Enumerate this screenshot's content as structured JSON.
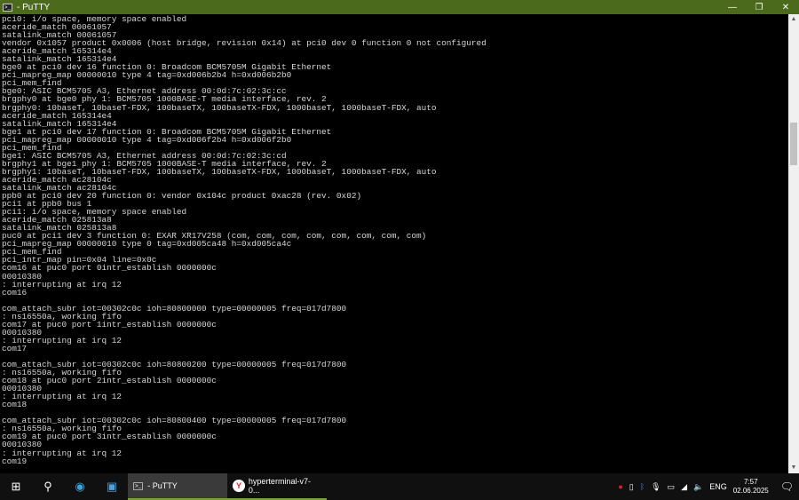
{
  "window": {
    "title": " - PuTTY",
    "minimize": "—",
    "maximize": "❐",
    "close": "✕"
  },
  "terminal": {
    "lines": [
      "pci0: i/o space, memory space enabled",
      "aceride_match 00061057",
      "satalink_match 00061057",
      "vendor 0x1057 product 0x0006 (host bridge, revision 0x14) at pci0 dev 0 function 0 not configured",
      "aceride_match 165314e4",
      "satalink_match 165314e4",
      "bge0 at pci0 dev 16 function 0: Broadcom BCM5705M Gigabit Ethernet",
      "pci_mapreg_map 00000010 type 4 tag=0xd006b2b4 h=0xd006b2b0",
      "pci_mem_find",
      "bge0: ASIC BCM5705 A3, Ethernet address 00:0d:7c:02:3c:cc",
      "brgphy0 at bge0 phy 1: BCM5705 1000BASE-T media interface, rev. 2",
      "brgphy0: 10baseT, 10baseT-FDX, 100baseTX, 100baseTX-FDX, 1000baseT, 1000baseT-FDX, auto",
      "aceride_match 165314e4",
      "satalink_match 165314e4",
      "bge1 at pci0 dev 17 function 0: Broadcom BCM5705M Gigabit Ethernet",
      "pci_mapreg_map 00000010 type 4 tag=0xd006f2b4 h=0xd006f2b0",
      "pci_mem_find",
      "bge1: ASIC BCM5705 A3, Ethernet address 00:0d:7c:02:3c:cd",
      "brgphy1 at bge1 phy 1: BCM5705 1000BASE-T media interface, rev. 2",
      "brgphy1: 10baseT, 10baseT-FDX, 100baseTX, 100baseTX-FDX, 1000baseT, 1000baseT-FDX, auto",
      "aceride_match ac28104c",
      "satalink_match ac28104c",
      "ppb0 at pci0 dev 20 function 0: vendor 0x104c product 0xac28 (rev. 0x02)",
      "pci1 at ppb0 bus 1",
      "pci1: i/o space, memory space enabled",
      "aceride_match 025813a8",
      "satalink_match 025813a8",
      "puc0 at pci1 dev 3 function 0: EXAR XR17V258 (com, com, com, com, com, com, com, com)",
      "pci_mapreg_map 00000010 type 0 tag=0xd005ca48 h=0xd005ca4c",
      "pci_mem_find",
      "pci_intr_map pin=0x04 line=0x0c",
      "com16 at puc0 port 0intr_establish 0000000c",
      "00010380",
      ": interrupting at irq 12",
      "com16",
      "",
      "com_attach_subr iot=00302c0c ioh=80800000 type=00000005 freq=017d7800",
      ": ns16550a, working fifo",
      "com17 at puc0 port 1intr_establish 0000000c",
      "00010380",
      ": interrupting at irq 12",
      "com17",
      "",
      "com_attach_subr iot=00302c0c ioh=80800200 type=00000005 freq=017d7800",
      ": ns16550a, working fifo",
      "com18 at puc0 port 2intr_establish 0000000c",
      "00010380",
      ": interrupting at irq 12",
      "com18",
      "",
      "com_attach_subr iot=00302c0c ioh=80800400 type=00000005 freq=017d7800",
      ": ns16550a, working fifo",
      "com19 at puc0 port 3intr_establish 0000000c",
      "00010380",
      ": interrupting at irq 12",
      "com19"
    ]
  },
  "taskbar": {
    "apps": [
      {
        "label": " - PuTTY"
      },
      {
        "label": "hyperterminal-v7-0..."
      }
    ],
    "language": "ENG",
    "time": "7:57",
    "date": "02.06.2025"
  },
  "colors": {
    "titlebar": "#4b6a1c",
    "accent": "#7aa52a"
  }
}
